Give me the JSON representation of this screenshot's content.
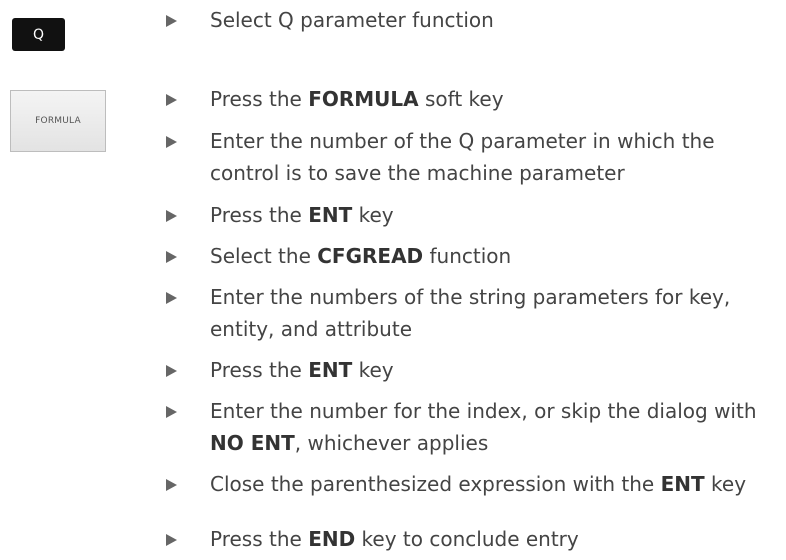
{
  "keys": {
    "q_label": "Q",
    "formula_label": "FORMULA"
  },
  "steps": [
    {
      "before": "Select Q parameter function",
      "bold": "",
      "after": ""
    },
    {
      "before": "Press the ",
      "bold": "FORMULA",
      "after": " soft key"
    },
    {
      "before": "Enter the number of the Q parameter in which the control is to save the machine parameter",
      "bold": "",
      "after": ""
    },
    {
      "before": "Press the ",
      "bold": "ENT",
      "after": " key"
    },
    {
      "before": "Select the ",
      "bold": "CFGREAD",
      "after": " function"
    },
    {
      "before": "Enter the numbers of the string parameters for key, entity, and attribute",
      "bold": "",
      "after": ""
    },
    {
      "before": "Press the ",
      "bold": "ENT",
      "after": " key"
    },
    {
      "before": "Enter the number for the index, or skip the dialog with ",
      "bold": "NO ENT",
      "after": ", whichever applies"
    },
    {
      "before": "Close the parenthesized expression with the ",
      "bold": "ENT",
      "after": " key"
    },
    {
      "before": "Press the ",
      "bold": "END",
      "after": " key to conclude entry"
    }
  ]
}
